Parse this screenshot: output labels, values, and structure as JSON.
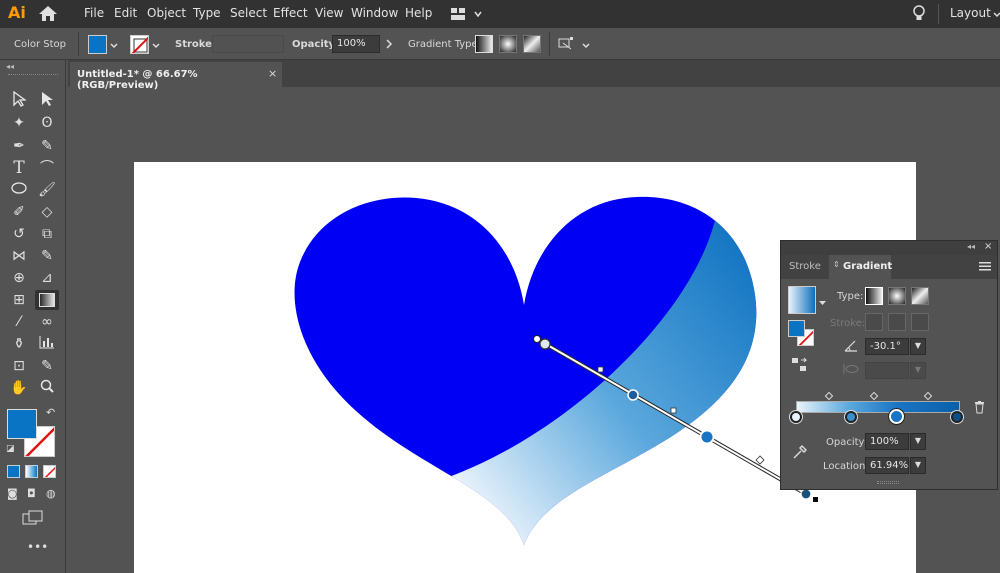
{
  "app": {
    "logo": "Ai"
  },
  "menu": {
    "items": [
      "File",
      "Edit",
      "Object",
      "Type",
      "Select",
      "Effect",
      "View",
      "Window",
      "Help"
    ],
    "workspace": "Layout"
  },
  "control": {
    "context_label": "Color Stop",
    "stroke_label": "Stroke:",
    "opacity_label": "Opacity:",
    "opacity_value": "100%",
    "gradient_type_label": "Gradient Type:"
  },
  "document": {
    "tab_title": "Untitled-1* @ 66.67% (RGB/Preview)",
    "close_glyph": "×"
  },
  "colors": {
    "heart_fill": "#0000f5",
    "gradient_start": "#e8f1fa",
    "gradient_end": "#0b70c0",
    "fill_swatch": "#0a74c4"
  },
  "icons": {
    "home": "home-icon",
    "workspace_switcher": "grid-icon",
    "search": "lightbulb-icon"
  },
  "gradient_panel": {
    "tabs": [
      "Stroke",
      "Gradient"
    ],
    "active_tab": "Gradient",
    "type_label": "Type:",
    "stroke_label": "Stroke:",
    "angle_value": "-30.1°",
    "opacity_label": "Opacity:",
    "opacity_value": "100%",
    "location_label": "Location:",
    "location_value": "61.94%",
    "stops": [
      0,
      0.32,
      0.62,
      1
    ]
  }
}
